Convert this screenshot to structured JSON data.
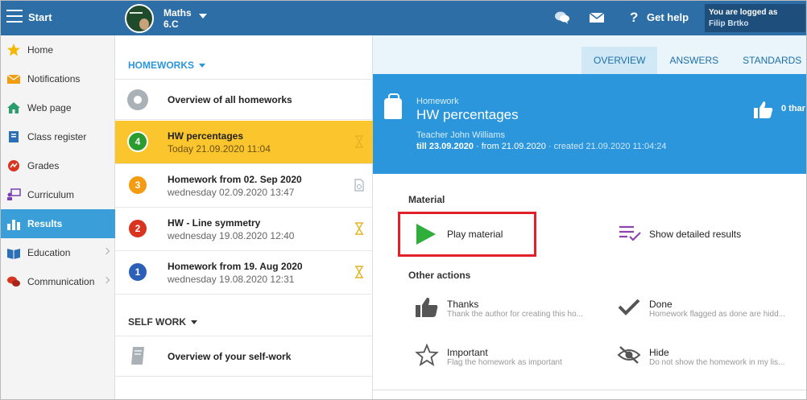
{
  "topbar": {
    "start_label": "Start",
    "class_subject": "Maths",
    "class_name": "6.C",
    "help_label": "Get help",
    "login_line1": "You are logged as",
    "login_user": "Filip Brtko"
  },
  "sidebar": {
    "items": [
      {
        "label": "Home",
        "icon": "star-icon"
      },
      {
        "label": "Notifications",
        "icon": "envelope-icon"
      },
      {
        "label": "Web page",
        "icon": "house-icon"
      },
      {
        "label": "Class register",
        "icon": "book-icon"
      },
      {
        "label": "Grades",
        "icon": "grade-icon"
      },
      {
        "label": "Curriculum",
        "icon": "teacher-icon"
      },
      {
        "label": "Results",
        "icon": "bar-chart-icon",
        "active": true
      },
      {
        "label": "Education",
        "icon": "open-book-icon"
      },
      {
        "label": "Communication",
        "icon": "chat-icon"
      }
    ]
  },
  "homeworks": {
    "section_label": "HOMEWORKS",
    "overview_label": "Overview of all homeworks",
    "items": [
      {
        "number": "4",
        "title": "HW percentages",
        "date": "Today 21.09.2020 11:04",
        "color": "#2a9d2f"
      },
      {
        "number": "3",
        "title": "Homework from 02. Sep 2020",
        "date": "wednesday 02.09.2020 13:47",
        "color": "#f39c12"
      },
      {
        "number": "2",
        "title": "HW - Line symmetry",
        "date": "wednesday 19.08.2020 12:40",
        "color": "#d9341f"
      },
      {
        "number": "1",
        "title": "Homework from 19. Aug 2020",
        "date": "wednesday 19.08.2020 12:31",
        "color": "#2b5fb8"
      }
    ]
  },
  "selfwork": {
    "section_label": "SELF WORK",
    "overview_label": "Overview of your self-work"
  },
  "detail": {
    "tabs": [
      "OVERVIEW",
      "ANSWERS",
      "STANDARDS"
    ],
    "kind": "Homework",
    "title": "HW percentages",
    "teacher": "Teacher John Williams",
    "till": "till 23.09.2020",
    "from": "· from 21.09.2020",
    "created": "· created 21.09.2020 11:04:24",
    "thanks_count": "0 thar",
    "material_label": "Material",
    "play_label": "Play material",
    "show_results_label": "Show detailed results",
    "other_actions_label": "Other actions",
    "actions": {
      "thanks_title": "Thanks",
      "thanks_sub": "Thank the author for creating this ho...",
      "done_title": "Done",
      "done_sub": "Homework flagged as done are hidd...",
      "important_title": "Important",
      "important_sub": "Flag the homework as important",
      "hide_title": "Hide",
      "hide_sub": "Do not show the homework in my lis..."
    }
  },
  "colors": {
    "topbar": "#2c6ea5",
    "accent_blue": "#2b96dc",
    "active_row": "#fbc52d",
    "highlight_box": "#e0212a",
    "play_green": "#2fae3b"
  }
}
